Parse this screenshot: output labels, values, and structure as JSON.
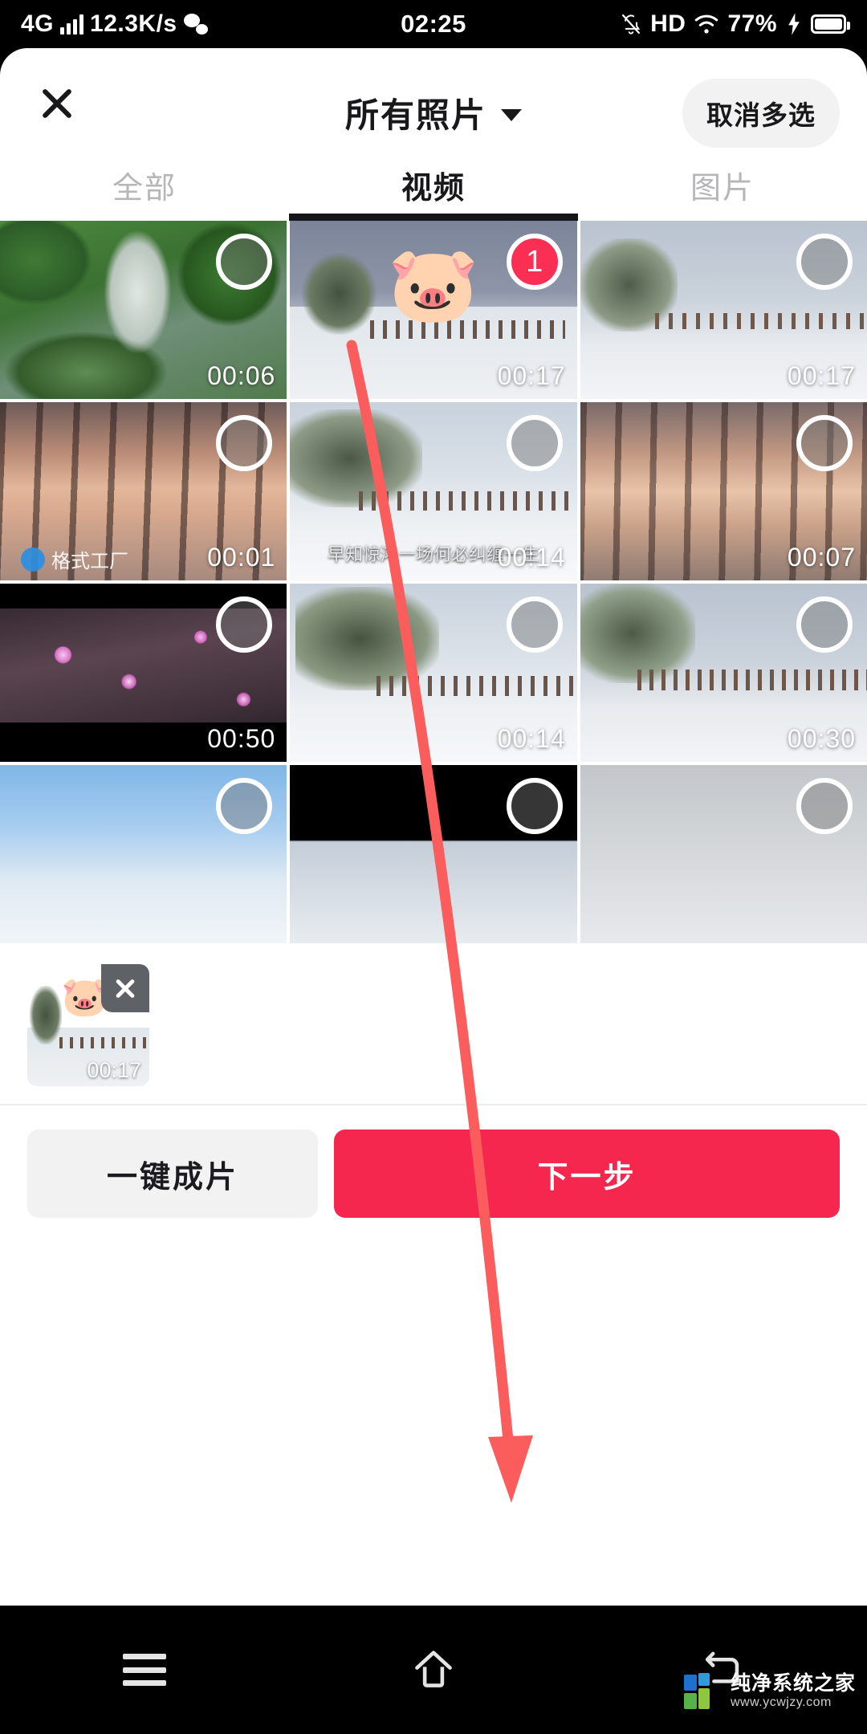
{
  "status_bar": {
    "network": "4G",
    "speed": "12.3K/s",
    "wechat_icon": "wechat-icon",
    "time": "02:25",
    "mute_icon": "bell-off-icon",
    "hd": "HD",
    "wifi_icon": "wifi-icon",
    "battery_percent": "77%",
    "charging_icon": "bolt-icon"
  },
  "header": {
    "close_icon": "close-icon",
    "title": "所有照片",
    "dropdown_icon": "chevron-down-icon",
    "multi_select_label": "取消多选"
  },
  "tabs": [
    {
      "label": "全部",
      "active": false
    },
    {
      "label": "视频",
      "active": true
    },
    {
      "label": "图片",
      "active": false
    }
  ],
  "grid": {
    "items": [
      {
        "duration": "00:06",
        "selected": false,
        "badge": "",
        "scene": "waterfall"
      },
      {
        "duration": "00:17",
        "selected": true,
        "badge": "1",
        "scene": "snow-bridge-pig"
      },
      {
        "duration": "00:17",
        "selected": false,
        "badge": "",
        "scene": "snow-bridge"
      },
      {
        "duration": "00:01",
        "selected": false,
        "badge": "",
        "scene": "sunset-trees",
        "watermark": "格式工厂"
      },
      {
        "duration": "00:14",
        "selected": false,
        "badge": "",
        "scene": "snow-bridge-wide",
        "subtitle": "早知惊鸿一场何必纠缠一生"
      },
      {
        "duration": "00:07",
        "selected": false,
        "badge": "",
        "scene": "sunset-trees-2"
      },
      {
        "duration": "00:50",
        "selected": false,
        "badge": "",
        "scene": "plum-blossom"
      },
      {
        "duration": "00:14",
        "selected": false,
        "badge": "",
        "scene": "snow-tree"
      },
      {
        "duration": "00:30",
        "selected": false,
        "badge": "",
        "scene": "snow-fence"
      },
      {
        "duration": "",
        "selected": false,
        "badge": "",
        "scene": "birds-sky"
      },
      {
        "duration": "",
        "selected": false,
        "badge": "",
        "scene": "dark-snow"
      },
      {
        "duration": "",
        "selected": false,
        "badge": "",
        "scene": "fog"
      }
    ]
  },
  "selected_strip": {
    "items": [
      {
        "duration": "00:17",
        "remove_icon": "close-icon",
        "pig": "🐷"
      }
    ]
  },
  "actions": {
    "secondary_label": "一键成片",
    "primary_label": "下一步"
  },
  "annotation": {
    "arrow_color": "#fb5c5c",
    "points_to": "下一步"
  },
  "navbar": {
    "menu_icon": "menu-icon",
    "home_icon": "home-icon",
    "back_icon": "back-icon"
  },
  "watermark": {
    "title": "纯净系统之家",
    "url": "www.ycwjzy.com"
  },
  "colors": {
    "primary": "#f6274e",
    "badge": "#fa2f53",
    "arrow": "#fb5c5c",
    "tab_active": "#18181b",
    "tab_inactive": "#b6b6b9"
  }
}
